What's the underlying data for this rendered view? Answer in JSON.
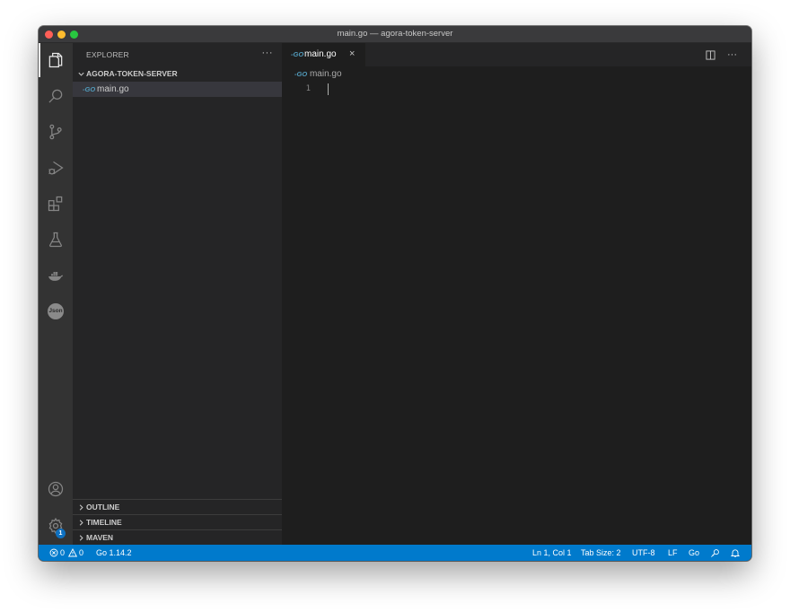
{
  "window": {
    "title": "main.go — agora-token-server"
  },
  "activity_bar": {
    "items": [
      "files-icon",
      "search-icon",
      "source-control-icon",
      "run-debug-icon",
      "extensions-icon",
      "testing-icon",
      "docker-icon",
      "json-icon"
    ],
    "json_label": "Json",
    "bottom_items": [
      "account-icon",
      "settings-gear-icon"
    ],
    "settings_badge": "1"
  },
  "sidebar": {
    "title": "EXPLORER",
    "more": "···",
    "folder": "AGORA-TOKEN-SERVER",
    "files": [
      {
        "icon_text": "-GO",
        "name": "main.go"
      }
    ],
    "sections": [
      "OUTLINE",
      "TIMELINE",
      "MAVEN"
    ]
  },
  "editor": {
    "tab": {
      "icon_text": "-GO",
      "label": "main.go",
      "close": "×"
    },
    "breadcrumb": {
      "icon_text": "-GO",
      "label": "main.go"
    },
    "line_numbers": [
      "1"
    ],
    "more_actions": "···"
  },
  "status_bar": {
    "errors": "0",
    "warnings": "0",
    "go_version": "Go 1.14.2",
    "position": "Ln 1, Col 1",
    "tab_size": "Tab Size: 2",
    "encoding": "UTF-8",
    "eol": "LF",
    "language": "Go"
  },
  "colors": {
    "status_bar": "#007acc",
    "activity_bar": "#333333",
    "sidebar": "#252526",
    "editor": "#1e1e1e",
    "go_icon": "#519aba",
    "badge": "#0e70c0"
  }
}
